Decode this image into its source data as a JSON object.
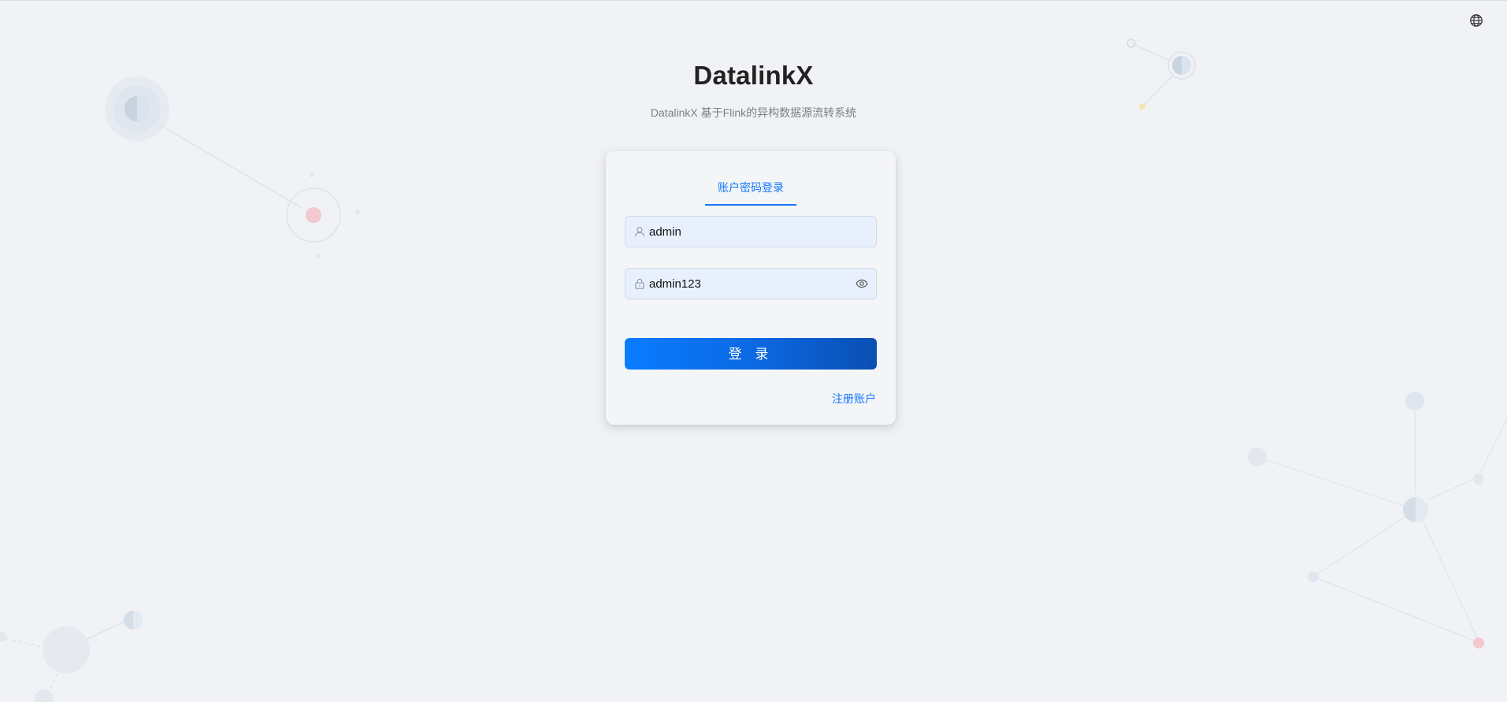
{
  "app": {
    "title": "DatalinkX",
    "subtitle": "DatalinkX 基于Flink的异构数据源流转系统"
  },
  "header": {
    "language_icon": "globe-icon"
  },
  "login": {
    "tab_label": "账户密码登录",
    "username_value": "admin",
    "password_value": "admin123",
    "username_icon": "user-icon",
    "password_icon": "lock-icon",
    "toggle_icon": "eye-icon",
    "submit_label": "登 录",
    "register_label": "注册账户"
  },
  "colors": {
    "accent": "#1677ff",
    "background": "#f0f2f5",
    "input_background": "#e8f0fe"
  }
}
